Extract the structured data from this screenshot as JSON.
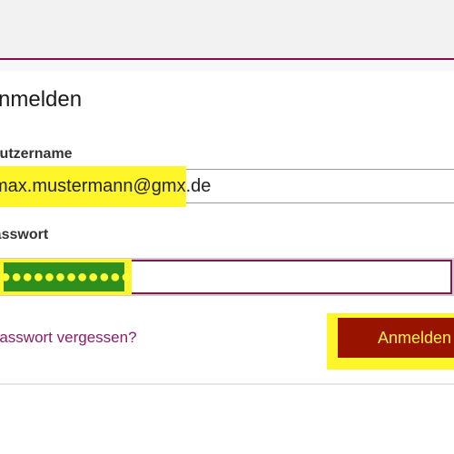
{
  "form": {
    "title": "Anmelden",
    "username_label": "Nutzername",
    "username_value": "max.mustermann@gmx.de",
    "password_label": "Passwort",
    "password_masked": "●●●●●●●●●●●●",
    "forgot_password_link": "Passwort vergessen?",
    "submit_label": "Anmelden"
  },
  "colors": {
    "accent": "#8b0a50",
    "button": "#991400",
    "button_text": "#ffef47",
    "highlight": "#fff62a",
    "link": "#8b1d6b"
  }
}
